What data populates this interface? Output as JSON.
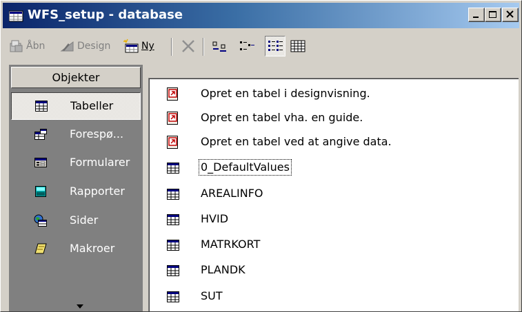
{
  "window": {
    "title": "WFS_setup - database"
  },
  "title_buttons": [
    {
      "name": "minimize-button",
      "icon": "minimize-icon"
    },
    {
      "name": "maximize-button",
      "icon": "maximize-icon"
    },
    {
      "name": "close-button",
      "icon": "close-icon"
    }
  ],
  "toolbar": {
    "open_label": "Åbn",
    "design_label": "Design",
    "new_label": "Ny",
    "delete_icon": "delete-x-icon",
    "view_buttons": [
      "large-icons-view",
      "small-icons-view",
      "list-view",
      "details-view"
    ],
    "active_view": "list-view"
  },
  "objects": {
    "header": "Objekter",
    "items": [
      {
        "label": "Tabeller",
        "icon": "table-icon",
        "selected": true
      },
      {
        "label": "Forespø...",
        "icon": "query-icon",
        "selected": false
      },
      {
        "label": "Formularer",
        "icon": "form-icon",
        "selected": false
      },
      {
        "label": "Rapporter",
        "icon": "report-icon",
        "selected": false
      },
      {
        "label": "Sider",
        "icon": "page-icon",
        "selected": false
      },
      {
        "label": "Makroer",
        "icon": "macro-icon",
        "selected": false
      }
    ]
  },
  "list": {
    "items": [
      {
        "label": "Opret en tabel i designvisning.",
        "icon": "shortcut-icon"
      },
      {
        "label": "Opret en tabel vha. en guide.",
        "icon": "shortcut-icon"
      },
      {
        "label": "Opret en tabel ved at angive data.",
        "icon": "shortcut-icon"
      },
      {
        "label": "0_DefaultValues",
        "icon": "table-icon",
        "focused": true
      },
      {
        "label": "AREALINFO",
        "icon": "table-icon"
      },
      {
        "label": "HVID",
        "icon": "table-icon"
      },
      {
        "label": "MATRKORT",
        "icon": "table-icon"
      },
      {
        "label": "PLANDK",
        "icon": "table-icon"
      },
      {
        "label": "SUT",
        "icon": "table-icon"
      }
    ]
  },
  "colors": {
    "title_start": "#0a246a",
    "title_end": "#a6caf0",
    "face": "#d4d0c8",
    "objbar": "#808080"
  }
}
